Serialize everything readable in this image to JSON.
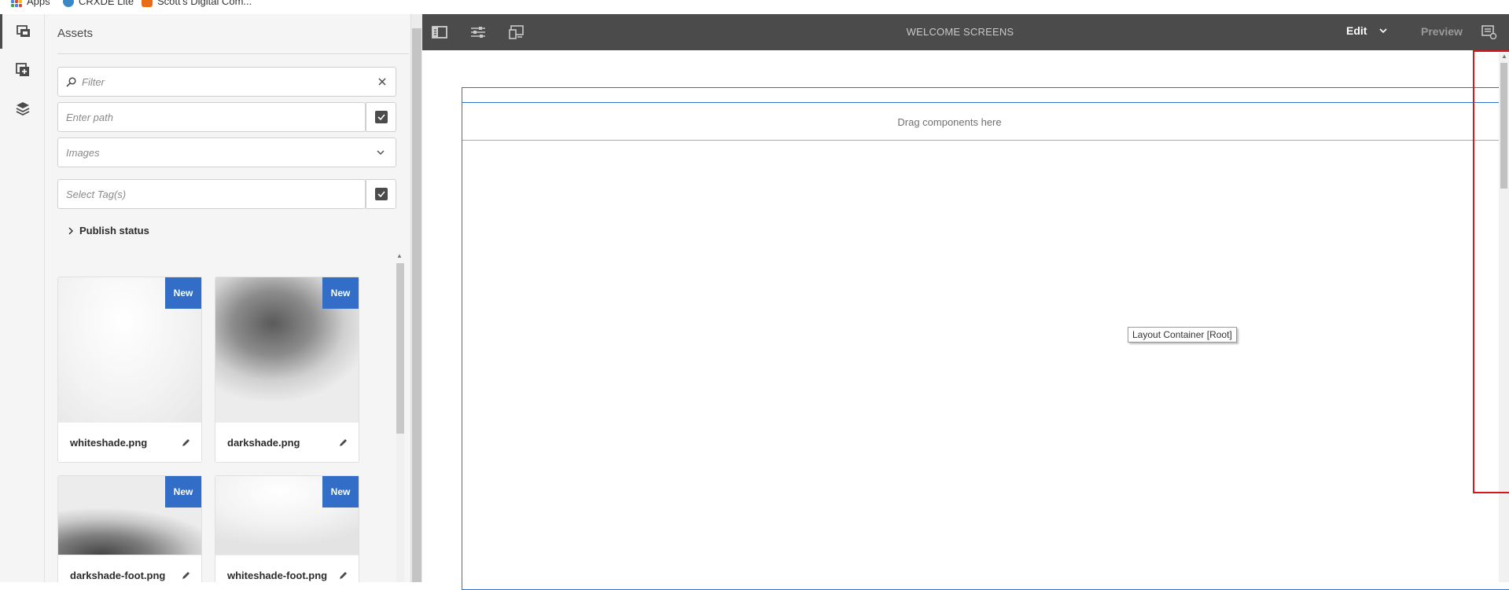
{
  "bookmarks": [
    "Apps",
    "CRXDE Lite",
    "Scott's Digital Com..."
  ],
  "colors": {
    "toolbar_bg": "#4b4b4b",
    "panel_bg": "#f5f5f5",
    "badge_bg": "#326ec8",
    "layout_outline": "#2d72c9",
    "highlight": "#d6161b"
  },
  "rail": {
    "items": [
      {
        "icon": "assets-icon",
        "active": true
      },
      {
        "icon": "components-icon",
        "active": false
      },
      {
        "icon": "content-tree-icon",
        "active": false
      }
    ]
  },
  "panel": {
    "title": "Assets",
    "filter_placeholder": "Filter",
    "path_placeholder": "Enter path",
    "type_selected": "Images",
    "tags_placeholder": "Select Tag(s)",
    "publish_status_label": "Publish status",
    "assets": [
      {
        "name": "whiteshade.png",
        "badge": "New"
      },
      {
        "name": "darkshade.png",
        "badge": "New"
      },
      {
        "name": "darkshade-foot.png",
        "badge": "New"
      },
      {
        "name": "whiteshade-foot.png",
        "badge": "New"
      }
    ]
  },
  "toolbar": {
    "page_title": "WELCOME SCREENS",
    "mode_label": "Edit",
    "preview_label": "Preview"
  },
  "canvas": {
    "drop_zone_text": "Drag components here",
    "tooltip_text": "Layout Container [Root]"
  }
}
